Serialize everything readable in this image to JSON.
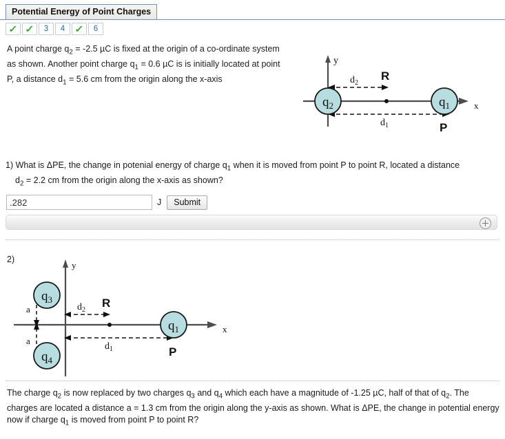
{
  "header": {
    "title": "Potential Energy of Point Charges"
  },
  "pager": {
    "tabs": [
      {
        "label": "✓",
        "state": "complete"
      },
      {
        "label": "✓",
        "state": "complete"
      },
      {
        "label": "3",
        "state": "number"
      },
      {
        "label": "4",
        "state": "number"
      },
      {
        "label": "✓",
        "state": "complete"
      },
      {
        "label": "6",
        "state": "number"
      }
    ],
    "check_color": "#3fa93f",
    "number_color": "#2c6ca8"
  },
  "intro": {
    "line1": "A point charge q2 = -2.5 µC is fixed at the origin of a co-ordinate",
    "line2": "system as shown. Another point charge q1 = 0.6 µC is is initially",
    "line3": "located at point P, a distance d1 = 5.6 cm from the origin along the x-",
    "line4": "axis",
    "full": "A point charge q2 = -2.5 µC is fixed at the origin of a co-ordinate system as shown. Another point charge q1 = 0.6 µC is is initially located at point P, a distance d1 = 5.6 cm from the origin along the x-axis"
  },
  "question1": {
    "number": "1)",
    "line1": "What is ΔPE, the change in potenial energy of charge q1 when it is moved from point P to point R, located a distance",
    "line2": "d2 = 2.2 cm from the origin along the x-axis as shown?",
    "answer_value": ".282",
    "answer_placeholder": "",
    "unit": "J",
    "submit_label": "Submit"
  },
  "question2": {
    "number": "2)",
    "line1": "The charge q2 is now replaced by two charges q3 and q4 which each have a magnitude of -1.25 µC, half of that of q2.",
    "line2": "The charges are located a distance a = 1.3 cm from the origin along the y-axis as shown. What is ΔPE, the change in",
    "line3": "potential energy now if charge q1 is moved from point P to point R?"
  },
  "figure1": {
    "axis_y_label": "y",
    "axis_x_label": "x",
    "charge_origin": "q2",
    "charge_right": "q1",
    "point_right": "P",
    "point_mid": "R",
    "dist_short": "d2",
    "dist_long": "d1",
    "circle_fill": "#b7dde1",
    "circle_stroke": "#1b1b1b"
  },
  "figure2": {
    "axis_y_label": "y",
    "axis_x_label": "x",
    "charge_top": "q3",
    "charge_bottom": "q4",
    "charge_right": "q1",
    "point_right": "P",
    "point_mid": "R",
    "dist_short": "d2",
    "dist_long": "d1",
    "dist_vert_top": "a",
    "dist_vert_bottom": "a",
    "circle_fill": "#b7dde1",
    "circle_stroke": "#1b1b1b"
  },
  "expand_bar": {
    "icon": "plus-circle-icon"
  }
}
